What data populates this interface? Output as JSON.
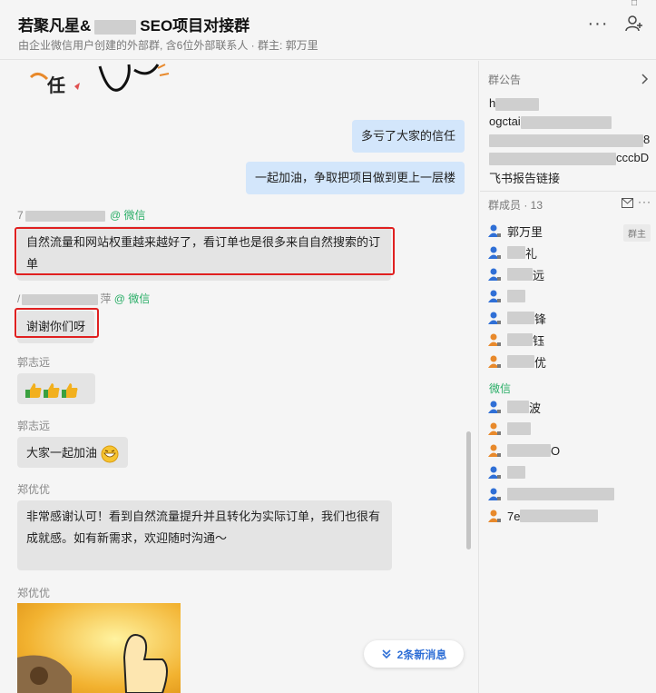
{
  "header": {
    "title": "若聚凡星&",
    "title_suffix": "SEO项目对接群",
    "subtitle": "由企业微信用户创建的外部群, 含6位外部联系人 · 群主: 郭万里"
  },
  "chat": {
    "messages": [
      {
        "text": "多亏了大家的信任"
      },
      {
        "text": "一起加油，争取把项目做到更上一层楼"
      },
      {
        "sender": "7",
        "sender_tag": "@ 微信",
        "text_line1": "自然流量和网站权重越来越好了，看订单也是很多来自自然搜索的订",
        "text_line2": "单"
      },
      {
        "sender": "/",
        "sender_suffix": "萍",
        "sender_tag": "@ 微信",
        "text": "谢谢你们呀"
      },
      {
        "sender": "郭志远"
      },
      {
        "sender": "郭志远",
        "text": "大家一起加油"
      },
      {
        "sender": "郑优优",
        "text_line1": "非常感谢认可！看到自然流量提升并且转化为实际订单，我们也很有",
        "text_line2": "成就感。如有新需求，欢迎随时沟通～"
      },
      {
        "sender": "郑优优"
      }
    ],
    "new_messages_label": "2条新消息"
  },
  "sidebar": {
    "notice_title": "群公告",
    "notice_lines": [
      "h",
      "ogctai",
      "8",
      "cccbD",
      "飞书报告链接"
    ],
    "members_title": "群成员 · 13",
    "owner_badge": "群主",
    "wechat_label": "微信",
    "members": [
      {
        "name": "郭万里",
        "color": "#2f6fd6"
      },
      {
        "name": "礼",
        "color": "#2f6fd6"
      },
      {
        "name": "远",
        "color": "#2f6fd6"
      },
      {
        "name": "",
        "color": "#2f6fd6"
      },
      {
        "name": "锋",
        "color": "#2f6fd6"
      },
      {
        "name": "钰",
        "color": "#e8892b"
      },
      {
        "name": "优",
        "color": "#e8892b"
      },
      {
        "name": "波",
        "color": "#2f6fd6"
      },
      {
        "name": "",
        "color": "#e8892b"
      },
      {
        "name": "O",
        "color": "#e8892b"
      },
      {
        "name": "",
        "color": "#2f6fd6"
      },
      {
        "name": "",
        "color": "#2f6fd6"
      },
      {
        "name": "7e",
        "color": "#e8892b"
      }
    ]
  },
  "colors": {
    "accent": "#2f6fd6",
    "wechat": "#2aae67",
    "highlight": "#e02020",
    "outgoing_bubble": "#d3e6fb",
    "incoming_bubble": "#e4e4e4"
  }
}
